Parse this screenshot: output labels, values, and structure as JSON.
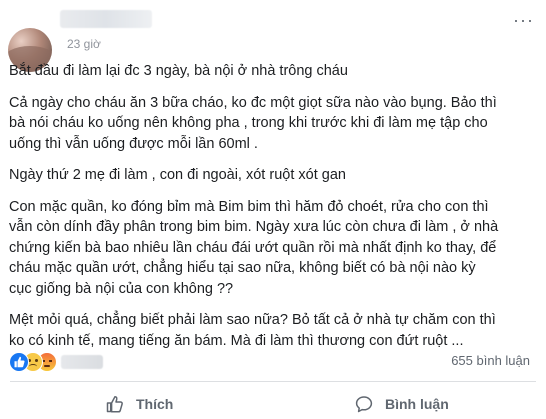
{
  "post": {
    "time": "23 giờ",
    "more_label": "···",
    "paragraphs": [
      "Bắt đầu đi làm lại đc 3 ngày, bà nội ở nhà trông cháu",
      "Cả ngày cho cháu ăn 3 bữa cháo, ko đc một giọt sữa nào vào bụng. Bảo thì\nbà nói cháu ko uống nên không pha , trong khi trước khi đi làm mẹ tập cho\nuống thì vẫn uống được mỗi lần 60ml .",
      "Ngày thứ 2 mẹ đi làm , con đi ngoài, xót ruột xót gan",
      "Con mặc quần, ko đóng bỉm mà Bim bim thì hăm đỏ choét, rửa cho con thì\nvẫn còn dính đầy phân trong bim bim. Ngày xưa lúc còn chưa đi làm , ở nhà\nchứng kiến bà bao nhiêu lần cháu đái ướt quần rồi mà nhất định ko thay, để\ncháu mặc quần ướt, chẳng hiểu tại sao nữa, không biết có bà nội nào kỳ\ncục giống bà nội của con không ??",
      "Mệt mỏi quá, chẳng biết phải làm sao nữa? Bỏ tất cả ở nhà tự chăm con thì\nko có kinh tế, mang tiếng ăn bám. Mà đi làm thì thương con đứt ruột ..."
    ]
  },
  "footer": {
    "comment_count": "655 bình luận",
    "like_label": "Thích",
    "comment_label": "Bình luận"
  },
  "colors": {
    "accent": "#1877f2",
    "text": "#1c1e21",
    "muted": "#606770"
  }
}
